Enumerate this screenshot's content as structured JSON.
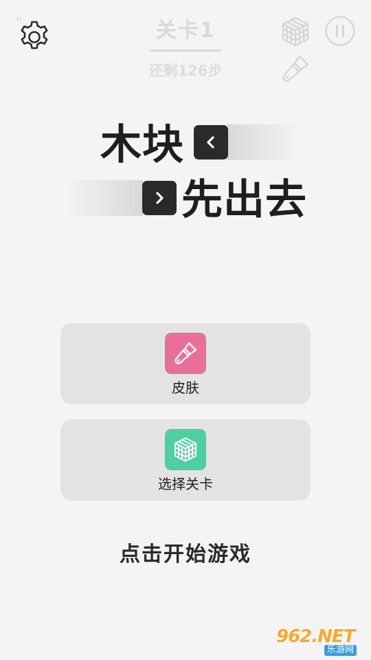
{
  "header": {
    "level_title": "关卡1",
    "steps_text": "还剩126步",
    "corner_text": "H"
  },
  "title": {
    "line1": "木块",
    "line2": "先出去"
  },
  "menu": {
    "skin_label": "皮肤",
    "level_select_label": "选择关卡"
  },
  "start_text": "点击开始游戏",
  "watermark": {
    "logo": "962.NET",
    "sub": "乐游网"
  },
  "colors": {
    "background": "#f4f4f4",
    "dark": "#2a2a2a",
    "skin_icon_bg": "#e96f98",
    "level_icon_bg": "#4fcfa0",
    "card_bg": "#e3e3e3",
    "faded_header": "#d9d9d9"
  },
  "icons": {
    "settings": "gear-icon",
    "cube": "cube-icon",
    "pause": "pause-icon",
    "brush": "paint-brush-icon",
    "arrow_left": "chevron-left-icon",
    "arrow_right": "chevron-right-icon"
  }
}
